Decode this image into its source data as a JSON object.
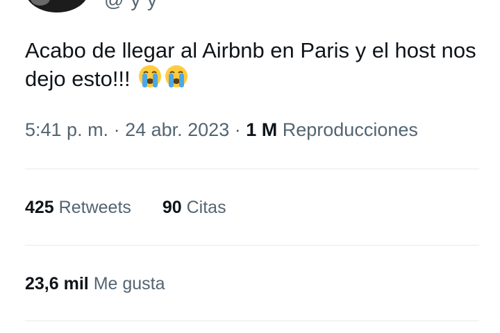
{
  "tweet": {
    "text": "Acabo de llegar al Airbnb en Paris y el host nos dejo esto!!!",
    "emojis": [
      "crying-face-emoji",
      "crying-face-emoji"
    ]
  },
  "meta": {
    "time": "5:41 p. m.",
    "separator1": " · ",
    "date": "24 abr. 2023",
    "separator2": " · ",
    "views_count": "1 M",
    "views_label": "Reproducciones"
  },
  "stats": {
    "retweets_count": "425",
    "retweets_label": "Retweets",
    "quotes_count": "90",
    "quotes_label": "Citas",
    "likes_count": "23,6 mil",
    "likes_label": "Me gusta"
  },
  "colors": {
    "text_primary": "#0f1419",
    "text_secondary": "#536471",
    "divider": "#e7e9ea",
    "emoji_face": "#ffcc3e",
    "emoji_tears": "#4ca7e8"
  }
}
